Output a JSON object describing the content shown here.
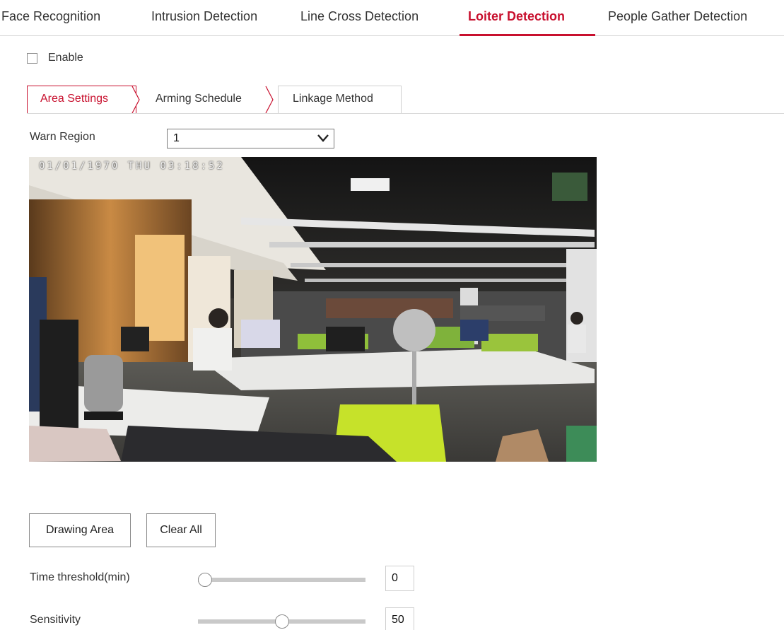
{
  "top_tabs": [
    {
      "label": "Face Recognition",
      "active": false
    },
    {
      "label": "Intrusion Detection",
      "active": false
    },
    {
      "label": "Line Cross Detection",
      "active": false
    },
    {
      "label": "Loiter Detection",
      "active": true
    },
    {
      "label": "People Gather Detection",
      "active": false
    }
  ],
  "enable": {
    "label": "Enable",
    "checked": false
  },
  "sub_tabs": [
    {
      "label": "Area Settings",
      "active": true
    },
    {
      "label": "Arming Schedule",
      "active": false
    },
    {
      "label": "Linkage Method",
      "active": false
    }
  ],
  "warn_region": {
    "label": "Warn Region",
    "value": "1"
  },
  "camera": {
    "osd_text": "01/01/1970 THU 03:18:52"
  },
  "buttons": {
    "drawing_area": "Drawing Area",
    "clear_all": "Clear All"
  },
  "time_threshold": {
    "label": "Time threshold(min)",
    "value": "0",
    "fraction": 0.0
  },
  "sensitivity": {
    "label": "Sensitivity",
    "value": "50",
    "fraction": 0.5
  },
  "colors": {
    "accent": "#c8102e",
    "border": "#d9d9d9",
    "text": "#333333"
  },
  "icons": {
    "select_arrow": "chevron-down-icon",
    "tab_separator": "chevron-right-icon"
  }
}
